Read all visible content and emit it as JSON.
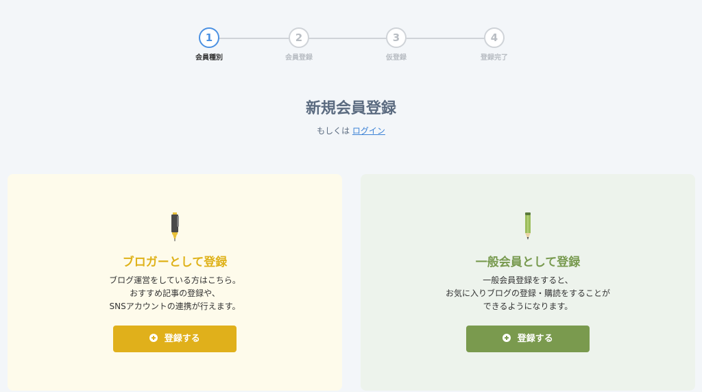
{
  "stepper": {
    "steps": [
      {
        "number": "1",
        "label": "会員種別",
        "active": true
      },
      {
        "number": "2",
        "label": "会員登録",
        "active": false
      },
      {
        "number": "3",
        "label": "仮登録",
        "active": false
      },
      {
        "number": "4",
        "label": "登録完了",
        "active": false
      }
    ]
  },
  "header": {
    "title": "新規会員登録",
    "subline_prefix": "もしくは",
    "login_link": "ログイン"
  },
  "cards": {
    "blogger": {
      "icon": "pen-icon",
      "title": "ブロガーとして登録",
      "desc_lines": [
        "ブログ運営をしている方はこちら。",
        "おすすめ記事の登録や、",
        "SNSアカウントの連携が行えます。"
      ],
      "button_label": "登録する"
    },
    "general": {
      "icon": "pencil-icon",
      "title": "一般会員として登録",
      "desc_lines": [
        "一般会員登録をすると、",
        "お気に入りブログの登録・購読をすることが",
        "できるようになります。"
      ],
      "button_label": "登録する"
    }
  },
  "colors": {
    "active_step": "#4a90e2",
    "blogger_accent": "#e0b01b",
    "general_accent": "#7a9a4e",
    "link": "#3b82d6"
  }
}
